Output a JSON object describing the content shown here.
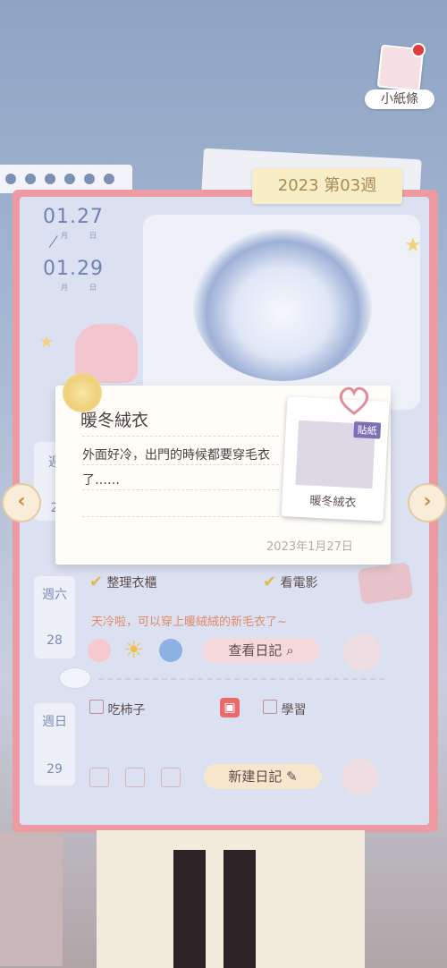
{
  "top_right": {
    "note_label": "小紙條"
  },
  "week_tab": "2023 第03週",
  "date_range": {
    "start": "01.27",
    "end": "01.29",
    "month_label": "月",
    "day_label": "日"
  },
  "days": [
    {
      "weekday": "週",
      "num": "2"
    },
    {
      "weekday": "週六",
      "num": "28"
    },
    {
      "weekday": "週日",
      "num": "29"
    }
  ],
  "saturday": {
    "tasks": [
      "整理衣櫃",
      "看電影"
    ],
    "diary_line": "天冷啦，可以穿上暖絨絨的新毛衣了~",
    "view_button": "查看日記"
  },
  "sunday": {
    "tasks": [
      "吃柿子",
      "學習"
    ],
    "new_button": "新建日記"
  },
  "popup": {
    "title": "暖冬絨衣",
    "text": "外面好冷，出門的時候都要穿毛衣了……",
    "date": "2023年1月27日",
    "sticker_badge": "貼紙",
    "sticker_name": "暖冬絨衣"
  },
  "nav": {
    "prev": "‹",
    "next": "›"
  },
  "colors": {
    "accent_pink": "#ee9aa2",
    "tab_yellow": "#f7edc7",
    "date_blue": "#6f82b0"
  }
}
